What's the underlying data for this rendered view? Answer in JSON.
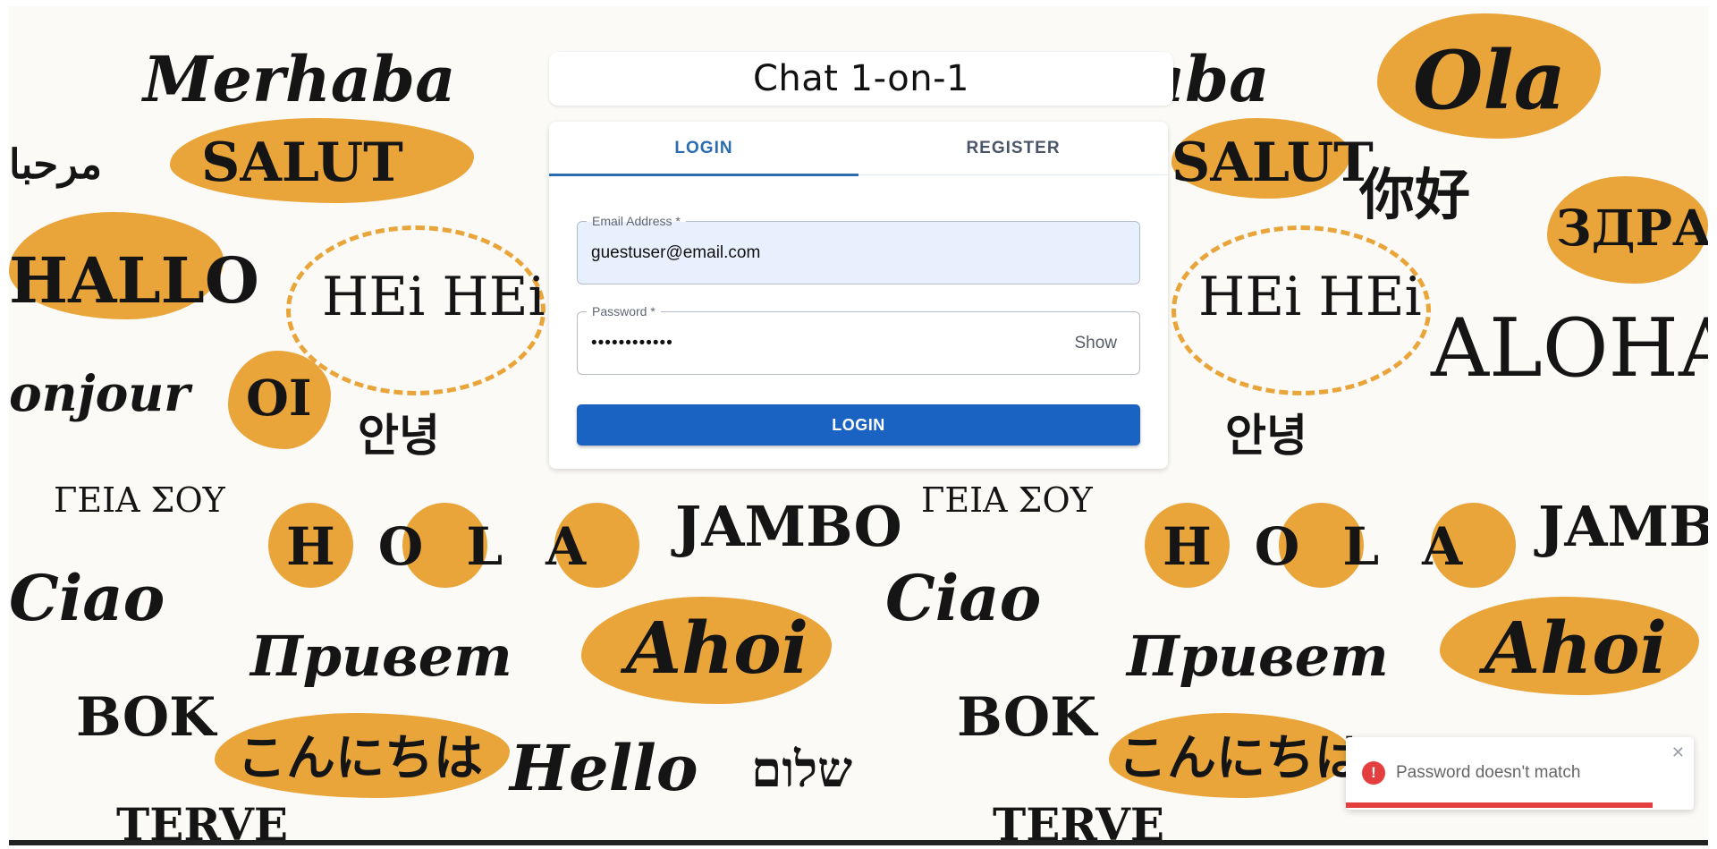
{
  "background": {
    "words": [
      "Merhaba",
      "SALUT",
      "HALLO",
      "HEi HEi",
      "onjour",
      "OI",
      "안녕",
      "ΓΕΙΑ ΣΟΥ",
      "Ciao",
      "HOLA",
      "JAMBO",
      "Ahoi",
      "Прuвem",
      "BOK",
      "こんにちは",
      "Hello",
      "שלום",
      "TERVE",
      "Ola",
      "你好",
      "ЗДРАВО",
      "ALOHA",
      "مرحبا"
    ]
  },
  "header": {
    "title": "Chat 1-on-1"
  },
  "tabs": [
    {
      "label": "LOGIN",
      "active": true
    },
    {
      "label": "REGISTER",
      "active": false
    }
  ],
  "form": {
    "email": {
      "label": "Email Address *",
      "value": "guestuser@email.com"
    },
    "password": {
      "label": "Password *",
      "masked_value": "••••••••••••",
      "show_label": "Show"
    },
    "submit_label": "LOGIN"
  },
  "toast": {
    "status": "error",
    "icon": "error-circle-icon",
    "icon_glyph": "!",
    "message": "Password doesn't match",
    "close_glyph": "✕"
  },
  "colors": {
    "accent": "#2b6cb0",
    "button": "#1b63c2",
    "error": "#e53e3e",
    "collage_orange": "#e9a53a"
  }
}
